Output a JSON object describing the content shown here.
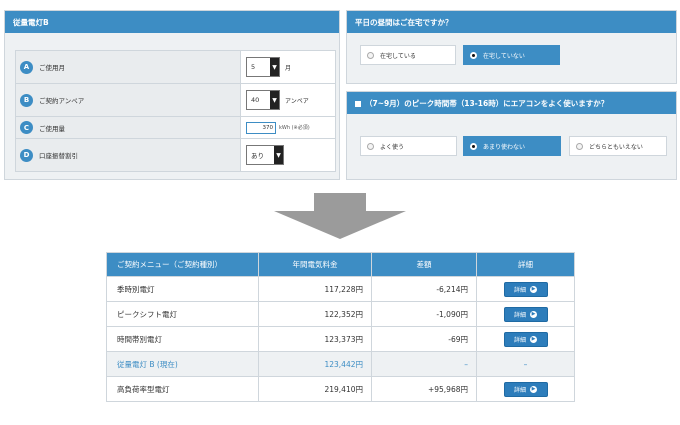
{
  "left_panel": {
    "title": "従量電灯B",
    "rows": [
      {
        "badge": "A",
        "label": "ご使用月",
        "value": "5",
        "unit": "月"
      },
      {
        "badge": "B",
        "label": "ご契約アンペア",
        "value": "40",
        "unit": "アンペア"
      },
      {
        "badge": "C",
        "label": "ご使用量",
        "value": "370",
        "unit": "kWh (※必須)"
      },
      {
        "badge": "D",
        "label": "口座振替割引",
        "value": "あり"
      }
    ]
  },
  "question1": {
    "title": "平日の昼間はご在宅ですか？",
    "options": [
      "在宅している",
      "在宅していない"
    ],
    "selected": "在宅していない"
  },
  "question2": {
    "title": "（7~9月）のピーク時間帯（13-16時）にエアコンをよく使いますか？",
    "options": [
      "よく使う",
      "あまり使わない",
      "どちらともいえない"
    ],
    "selected": "あまり使わない"
  },
  "table": {
    "headers": [
      "ご契約メニュー（ご契約種別）",
      "年間電気料金",
      "差額",
      "詳細"
    ],
    "rows": [
      {
        "name": "季時別電灯",
        "annual": "117,228円",
        "diff": "-6,214円",
        "detail": "詳細"
      },
      {
        "name": "ピークシフト電灯",
        "annual": "122,352円",
        "diff": "-1,090円",
        "detail": "詳細"
      },
      {
        "name": "時間帯別電灯",
        "annual": "123,373円",
        "diff": "-69円",
        "detail": "詳細"
      },
      {
        "name": "従量電灯 B (現在)",
        "annual": "123,442円",
        "diff": "–",
        "detail": "–"
      },
      {
        "name": "高負荷率型電灯",
        "annual": "219,410円",
        "diff": "+95,968円",
        "detail": "詳細"
      }
    ],
    "current_row": 3
  },
  "colors": {
    "accent": "#3d8dc4",
    "button": "#2d7dbb",
    "arrow": "#9b9b9b"
  },
  "icons": {
    "select": "triangle-down-icon",
    "detail": "chevron-right-circle-icon",
    "header": "square-icon"
  }
}
